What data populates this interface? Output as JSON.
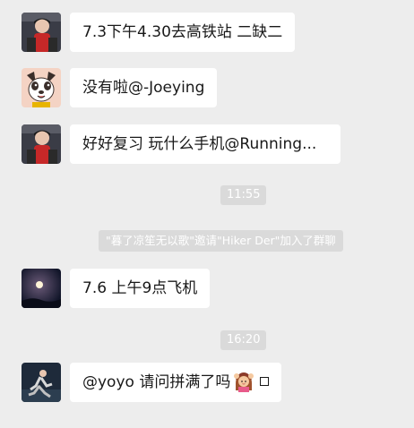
{
  "messages": [
    {
      "text": "7.3下午4.30去高铁站 二缺二",
      "avatar": "avatar-boy-red-shirt"
    },
    {
      "text": "没有啦@-Joeying",
      "avatar": "avatar-cartoon-dog"
    },
    {
      "text": "好好复习 玩什么手机@Running...",
      "avatar": "avatar-boy-red-shirt"
    },
    {
      "text": "7.6 上午9点飞机",
      "avatar": "avatar-moon-night"
    },
    {
      "text": "@yoyo 请问拼满了吗",
      "avatar": "avatar-girl-running",
      "emoji": "woman-gesturing-ok-emoji"
    }
  ],
  "time_labels": [
    "11:55",
    "16:20"
  ],
  "system_notice": "\"暮了凉笙无以歌\"邀请\"Hiker Der\"加入了群聊"
}
